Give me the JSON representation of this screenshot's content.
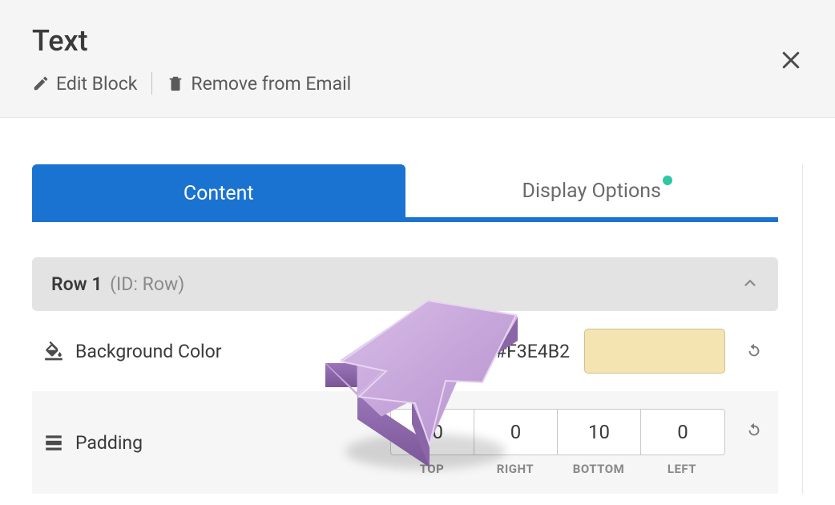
{
  "header": {
    "title": "Text",
    "edit_label": "Edit Block",
    "remove_label": "Remove from Email"
  },
  "tabs": {
    "content": "Content",
    "display": "Display Options"
  },
  "section": {
    "row_label": "Row 1",
    "row_id": "(ID: Row)"
  },
  "properties": {
    "bg_label": "Background Color",
    "bg_value": "#F3E4B2",
    "bg_swatch": "#F3E4B2",
    "padding_label": "Padding",
    "padding": {
      "top": "10",
      "right": "0",
      "bottom": "10",
      "left": "0",
      "top_lbl": "TOP",
      "right_lbl": "RIGHT",
      "bottom_lbl": "BOTTOM",
      "left_lbl": "LEFT"
    }
  }
}
